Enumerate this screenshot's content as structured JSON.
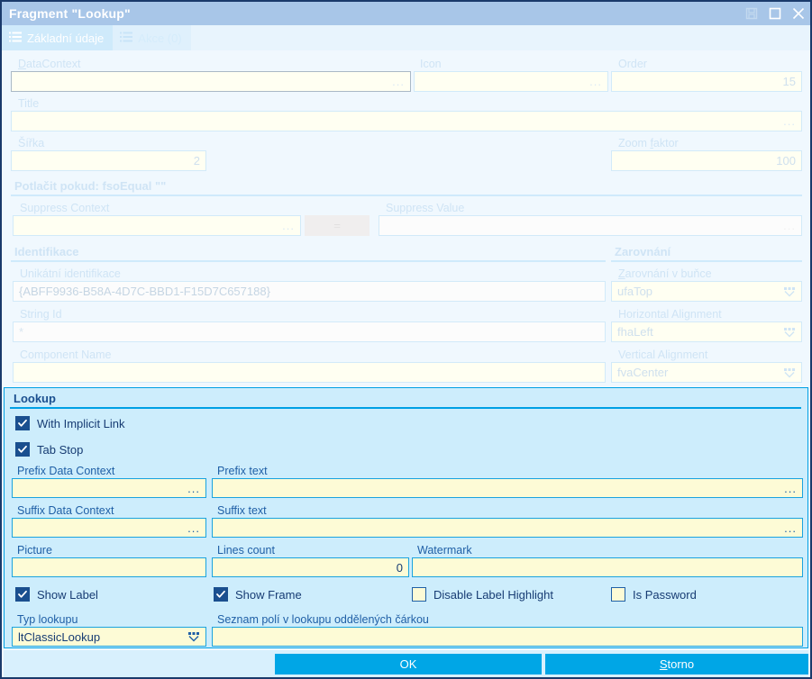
{
  "window": {
    "title": "Fragment \"Lookup\"",
    "buttons": {
      "save": "save-icon",
      "maximize": "maximize-icon",
      "close": "close-icon"
    }
  },
  "tabs": [
    {
      "label": "Základní údaje",
      "active": true
    },
    {
      "label": "Akce (0)",
      "active": false
    }
  ],
  "basic": {
    "datacontext": {
      "label": "DataContext",
      "accel": "D",
      "value": "",
      "ellipsis": "..."
    },
    "icon": {
      "label": "Icon",
      "value": "",
      "ellipsis": "..."
    },
    "order": {
      "label": "Order",
      "value": "15"
    },
    "title": {
      "label": "Title",
      "value": "",
      "ellipsis": "..."
    },
    "sirka": {
      "label": "Šířka",
      "value": "2"
    },
    "zoom": {
      "label": "Zoom faktor",
      "accel": "f",
      "value": "100"
    },
    "suppress_header": "Potlačit pokud:  fsoEqual \"\"",
    "suppress_context": {
      "label": "Suppress Context",
      "value": "",
      "ellipsis": "..."
    },
    "suppress_op_button": "=",
    "suppress_value": {
      "label": "Suppress Value",
      "value": "",
      "ellipsis": "..."
    },
    "identifikace": {
      "title": "Identifikace",
      "unique_id": {
        "label": "Unikátní identifikace",
        "value": "{ABFF9936-B58A-4D7C-BBD1-F15D7C657188}"
      },
      "string_id": {
        "label": "String Id",
        "value": "*"
      },
      "component_name": {
        "label": "Component Name",
        "value": ""
      }
    },
    "zarovnani": {
      "title": "Zarovnání",
      "cell": {
        "label": "Zarovnání v buňce",
        "accel": "Z",
        "value": "ufaTop"
      },
      "horizontal": {
        "label": "Horizontal Alignment",
        "value": "fhaLeft"
      },
      "vertical": {
        "label": "Vertical Alignment",
        "value": "fvaCenter"
      }
    }
  },
  "lookup": {
    "title": "Lookup",
    "with_implicit_link": {
      "label": "With Implicit Link",
      "checked": true
    },
    "tab_stop": {
      "label": "Tab Stop",
      "checked": true
    },
    "prefix_data_context": {
      "label": "Prefix Data Context",
      "value": "",
      "ellipsis": "..."
    },
    "prefix_text": {
      "label": "Prefix text",
      "value": "",
      "ellipsis": "..."
    },
    "suffix_data_context": {
      "label": "Suffix Data Context",
      "value": "",
      "ellipsis": "..."
    },
    "suffix_text": {
      "label": "Suffix text",
      "value": "",
      "ellipsis": "..."
    },
    "picture": {
      "label": "Picture",
      "value": ""
    },
    "lines_count": {
      "label": "Lines count",
      "value": "0"
    },
    "watermark": {
      "label": "Watermark",
      "value": ""
    },
    "show_label": {
      "label": "Show Label",
      "checked": true
    },
    "show_frame": {
      "label": "Show Frame",
      "checked": true
    },
    "disable_label_highlight": {
      "label": "Disable Label Highlight",
      "checked": false
    },
    "is_password": {
      "label": "Is Password",
      "checked": false
    },
    "typ_lookupu": {
      "label": "Typ lookupu",
      "value": "ltClassicLookup"
    },
    "field_list": {
      "label": "Seznam polí v lookupu oddělených čárkou",
      "value": ""
    }
  },
  "footer": {
    "ok": "OK",
    "cancel_prefix": "S",
    "cancel_rest": "torno"
  },
  "colors": {
    "accent": "#00a6e6",
    "lookup_panel": "#cdedfc",
    "top_panel": "#f0f8fe",
    "titlebar": "#a8c6e8",
    "input_yellow": "#fdfbd6",
    "border_window": "#1a3a6b"
  }
}
